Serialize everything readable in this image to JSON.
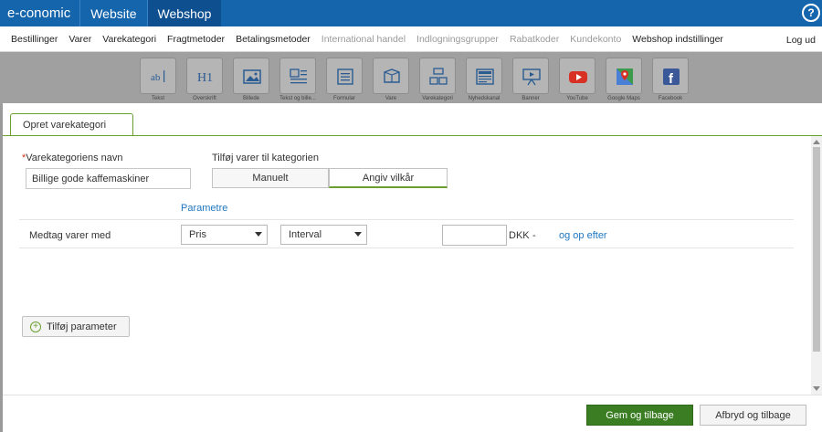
{
  "topbar": {
    "brand": "e-conomic",
    "tabs": [
      {
        "label": "Website"
      },
      {
        "label": "Webshop"
      }
    ],
    "help_label": "?"
  },
  "nav": {
    "items": [
      {
        "label": "Bestillinger"
      },
      {
        "label": "Varer"
      },
      {
        "label": "Varekategori"
      },
      {
        "label": "Fragtmetoder"
      },
      {
        "label": "Betalingsmetoder"
      },
      {
        "label": "International handel"
      },
      {
        "label": "Indlogningsgrupper"
      },
      {
        "label": "Rabatkoder"
      },
      {
        "label": "Kundekonto"
      },
      {
        "label": "Webshop indstillinger"
      }
    ],
    "logout": "Log ud"
  },
  "toolbar": {
    "widgets": [
      {
        "label": "Tekst",
        "icon": "text-icon",
        "glyph": "ab|"
      },
      {
        "label": "Overskrift",
        "icon": "heading-icon",
        "glyph": "H1"
      },
      {
        "label": "Billede",
        "icon": "image-icon"
      },
      {
        "label": "Tekst og bille...",
        "icon": "text-image-icon"
      },
      {
        "label": "Formular",
        "icon": "form-icon"
      },
      {
        "label": "Vare",
        "icon": "product-icon"
      },
      {
        "label": "Varekategori",
        "icon": "category-icon"
      },
      {
        "label": "Nyhedskanal",
        "icon": "news-icon"
      },
      {
        "label": "Banner",
        "icon": "banner-icon"
      },
      {
        "label": "YouTube",
        "icon": "youtube-icon"
      },
      {
        "label": "Google Maps",
        "icon": "google-maps-icon"
      },
      {
        "label": "Facebook",
        "icon": "facebook-icon"
      }
    ]
  },
  "panel": {
    "tab_label": "Opret varekategori",
    "name_field": {
      "required_mark": "*",
      "label": "Varekategoriens navn",
      "value": "Billige gode kaffemaskiner"
    },
    "add_products": {
      "label": "Tilføj varer til kategorien",
      "options": [
        {
          "label": "Manuelt",
          "selected": false
        },
        {
          "label": "Angiv vilkår",
          "selected": true
        }
      ]
    },
    "parameters": {
      "header": "Parametre",
      "row_label": "Medtag varer med",
      "field_select": "Pris",
      "operator_select": "Interval",
      "amount_value": "",
      "currency": "DKK",
      "dash": "-",
      "after_link": "og op efter"
    },
    "add_parameter_button": "Tilføj parameter",
    "save_button": "Gem og tilbage",
    "cancel_button": "Afbryd og tilbage"
  },
  "colors": {
    "topbar": "#1565ad",
    "topbar_active": "#0d4f8f",
    "accent_green": "#6b9f30",
    "save_green": "#3a7d22",
    "link_blue": "#1e77c0"
  }
}
